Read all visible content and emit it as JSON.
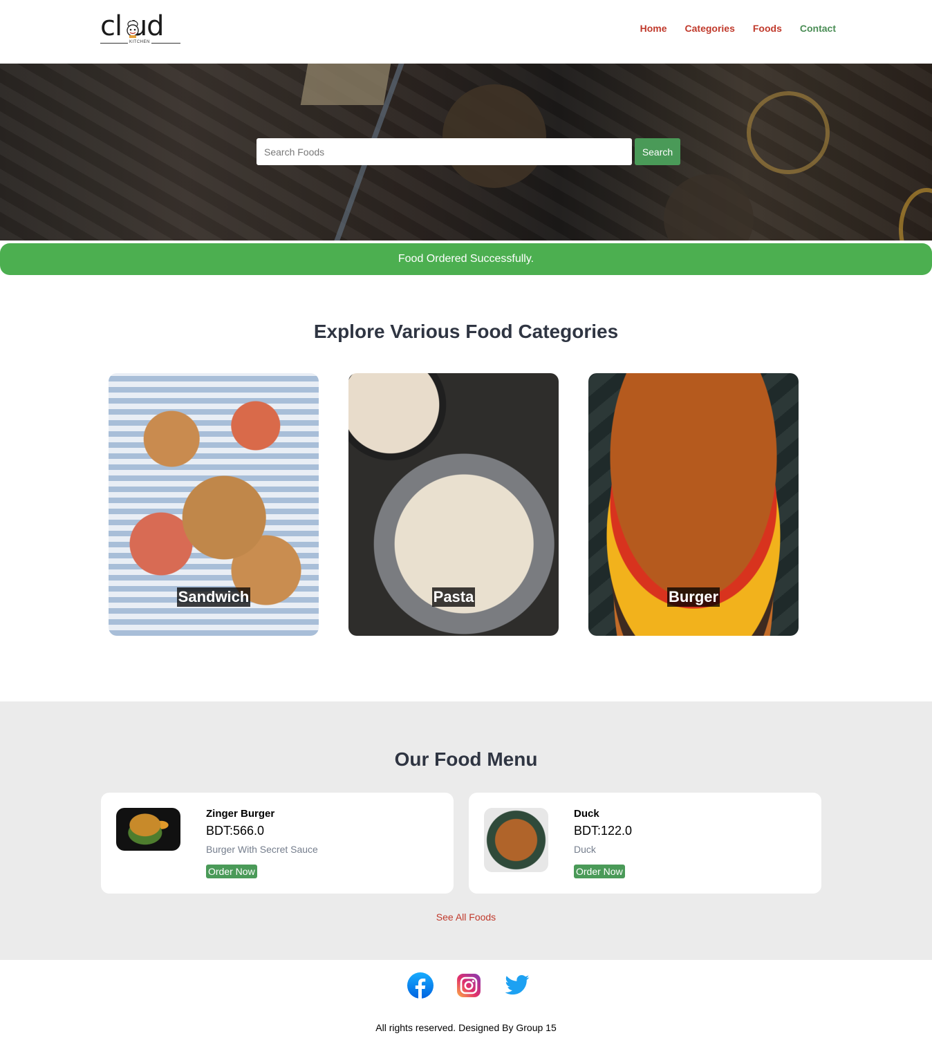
{
  "brand": {
    "logo_text": "cl ud",
    "logo_sub": "KITCHEN"
  },
  "nav": {
    "items": [
      {
        "label": "Home"
      },
      {
        "label": "Categories"
      },
      {
        "label": "Foods"
      },
      {
        "label": "Contact"
      }
    ]
  },
  "search": {
    "placeholder": "Search Foods",
    "button_label": "Search"
  },
  "alert": {
    "message": "Food Ordered Successfully."
  },
  "categories": {
    "title": "Explore Various Food Categories",
    "items": [
      {
        "label": "Sandwich"
      },
      {
        "label": "Pasta"
      },
      {
        "label": "Burger"
      }
    ]
  },
  "food_menu": {
    "title": "Our Food Menu",
    "items": [
      {
        "name": "Zinger Burger",
        "price": "BDT:566.0",
        "description": "Burger With Secret Sauce",
        "button_label": "Order Now"
      },
      {
        "name": "Duck",
        "price": "BDT:122.0",
        "description": "Duck",
        "button_label": "Order Now"
      }
    ],
    "see_all_label": "See All Foods"
  },
  "footer": {
    "social": [
      {
        "icon": "facebook-icon"
      },
      {
        "icon": "instagram-icon"
      },
      {
        "icon": "twitter-icon"
      }
    ],
    "copyright": "All rights reserved. Designed By Group 15"
  },
  "colors": {
    "accent_green": "#4a9a58",
    "success_green": "#4caf50",
    "link_red": "#c0392b",
    "heading": "#2f3542"
  }
}
